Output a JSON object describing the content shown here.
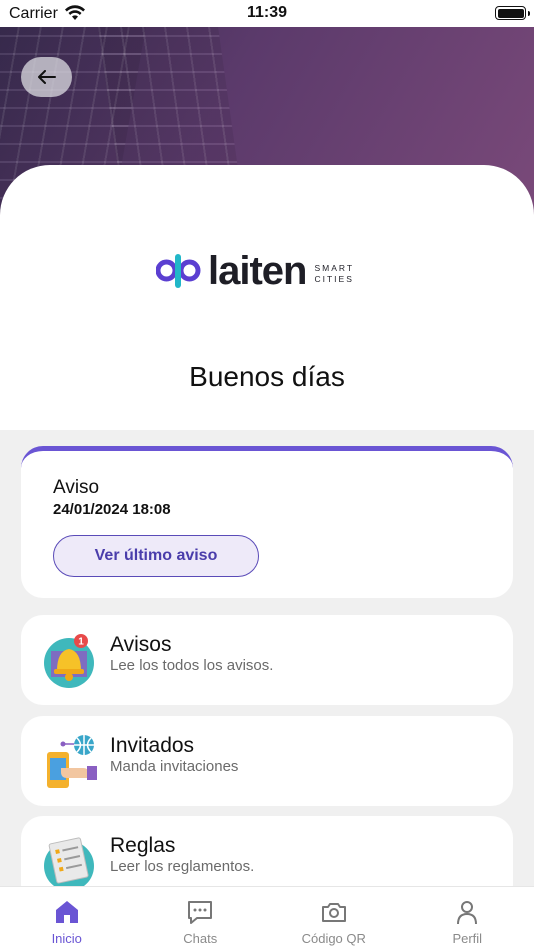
{
  "status_bar": {
    "carrier": "Carrier",
    "time": "11:39"
  },
  "header": {
    "brand_word": "laiten",
    "brand_tagline_1": "SMART",
    "brand_tagline_2": "CITIES",
    "greeting": "Buenos días"
  },
  "notice": {
    "title": "Aviso",
    "date": "24/01/2024 18:08",
    "button_label": "Ver último aviso"
  },
  "menu": [
    {
      "title": "Avisos",
      "subtitle": "Lee los todos los avisos.",
      "icon": "bell-notification-icon",
      "badge": "1"
    },
    {
      "title": "Invitados",
      "subtitle": "Manda invitaciones",
      "icon": "invitation-phone-icon"
    },
    {
      "title": "Reglas",
      "subtitle": "Leer los reglamentos.",
      "icon": "rules-document-icon"
    }
  ],
  "tabs": [
    {
      "label": "Inicio",
      "icon": "home-icon",
      "active": true
    },
    {
      "label": "Chats",
      "icon": "chat-icon"
    },
    {
      "label": "Código QR",
      "icon": "camera-icon"
    },
    {
      "label": "Perfil",
      "icon": "user-icon"
    }
  ],
  "colors": {
    "accent": "#6a55d4",
    "hero": "#5b3a6b",
    "background": "#f0f0f0"
  }
}
